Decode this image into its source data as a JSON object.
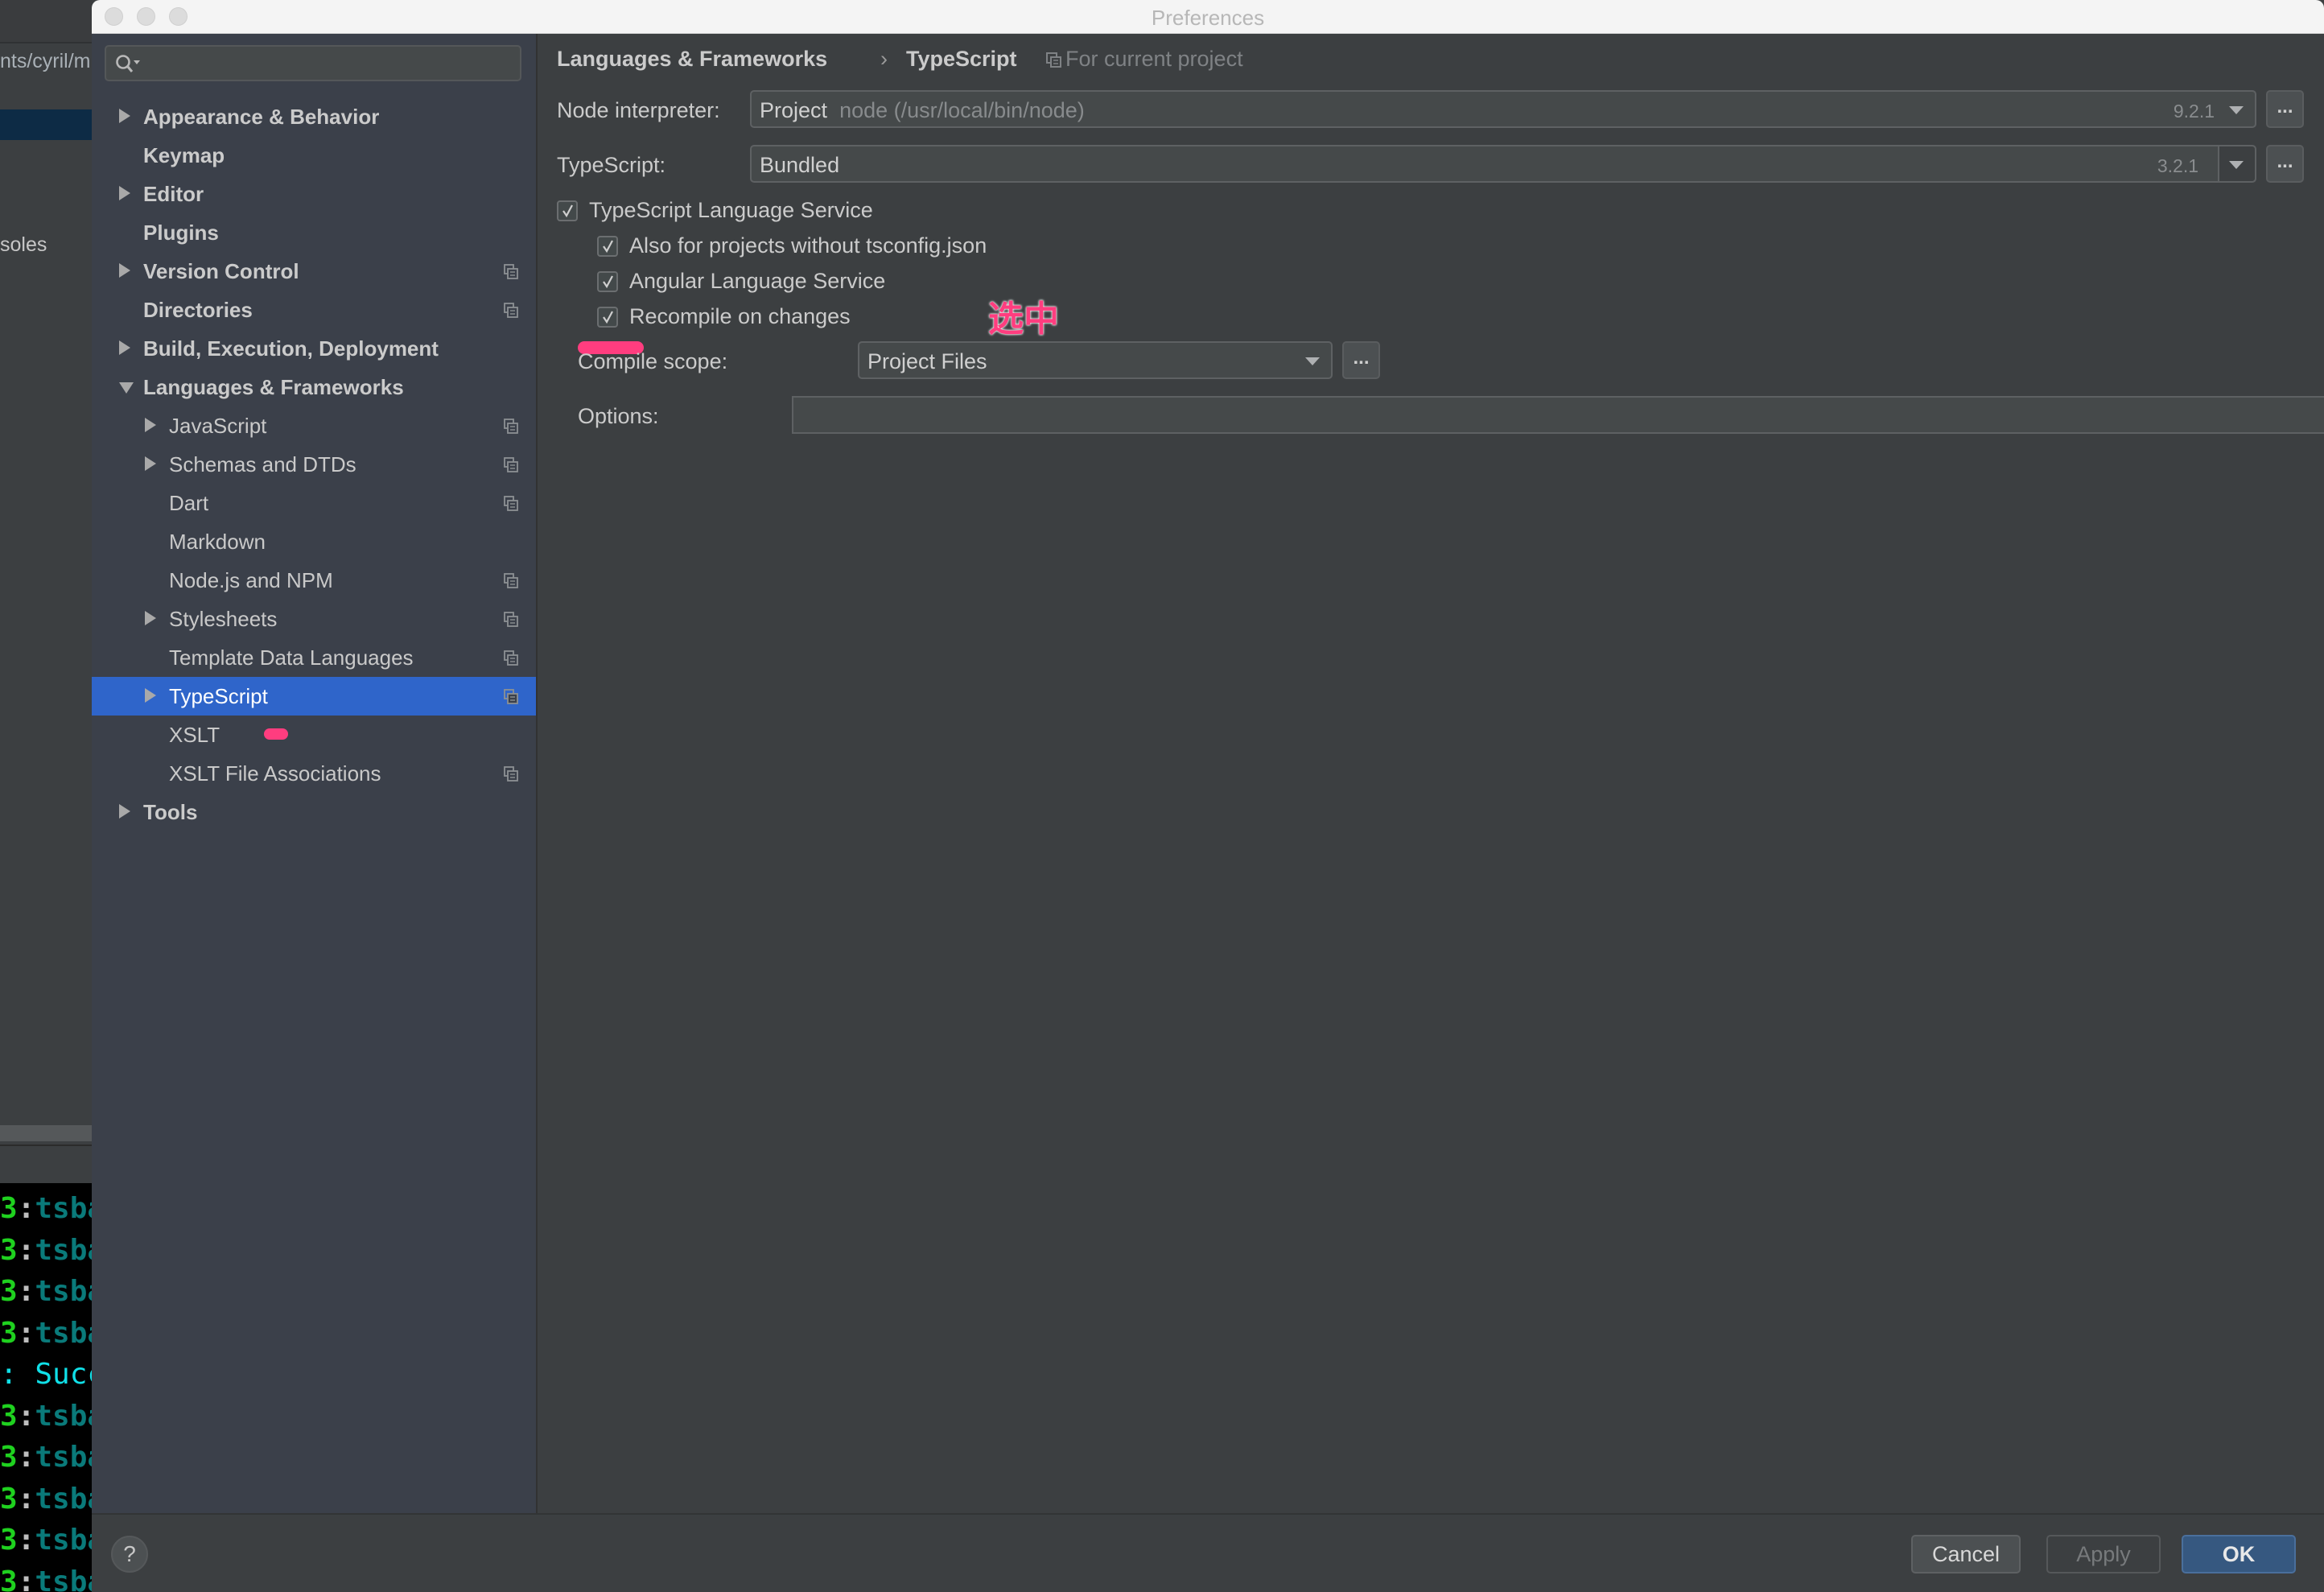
{
  "window": {
    "title": "Preferences"
  },
  "background_ide": {
    "path_fragment": "nts/cyril/m",
    "consoles_fragment": "soles",
    "terminal_lines": [
      {
        "num": "3",
        "colon": ":",
        "host": "tsba"
      },
      {
        "num": "3",
        "colon": ":",
        "host": "tsba"
      },
      {
        "num": "3",
        "colon": ":",
        "host": "tsba"
      },
      {
        "num": "3",
        "colon": ":",
        "host": "tsba"
      },
      {
        "num": "",
        "colon": ":",
        "host": "Succ",
        "type": "success"
      },
      {
        "num": "3",
        "colon": ":",
        "host": "tsba"
      },
      {
        "num": "3",
        "colon": ":",
        "host": "tsba"
      },
      {
        "num": "3",
        "colon": ":",
        "host": "tsba"
      },
      {
        "num": "3",
        "colon": ":",
        "host": "tsba"
      },
      {
        "num": "3",
        "colon": ":",
        "host": "tsba"
      }
    ]
  },
  "sidebar": {
    "search": {
      "placeholder": "",
      "value": "",
      "icon": "search-icon"
    },
    "items": [
      {
        "label": "Appearance & Behavior",
        "level": 0,
        "expandable": true,
        "expanded": false,
        "project_icon": false
      },
      {
        "label": "Keymap",
        "level": 0,
        "expandable": false,
        "project_icon": false
      },
      {
        "label": "Editor",
        "level": 0,
        "expandable": true,
        "expanded": false,
        "project_icon": false
      },
      {
        "label": "Plugins",
        "level": 0,
        "expandable": false,
        "project_icon": false
      },
      {
        "label": "Version Control",
        "level": 0,
        "expandable": true,
        "expanded": false,
        "project_icon": true
      },
      {
        "label": "Directories",
        "level": 0,
        "expandable": false,
        "project_icon": true
      },
      {
        "label": "Build, Execution, Deployment",
        "level": 0,
        "expandable": true,
        "expanded": false,
        "project_icon": false
      },
      {
        "label": "Languages & Frameworks",
        "level": 0,
        "expandable": true,
        "expanded": true,
        "project_icon": false
      },
      {
        "label": "JavaScript",
        "level": 1,
        "expandable": true,
        "expanded": false,
        "project_icon": true
      },
      {
        "label": "Schemas and DTDs",
        "level": 1,
        "expandable": true,
        "expanded": false,
        "project_icon": true
      },
      {
        "label": "Dart",
        "level": 1,
        "expandable": false,
        "project_icon": true
      },
      {
        "label": "Markdown",
        "level": 1,
        "expandable": false,
        "project_icon": false
      },
      {
        "label": "Node.js and NPM",
        "level": 1,
        "expandable": false,
        "project_icon": true
      },
      {
        "label": "Stylesheets",
        "level": 1,
        "expandable": true,
        "expanded": false,
        "project_icon": true
      },
      {
        "label": "Template Data Languages",
        "level": 1,
        "expandable": false,
        "project_icon": true
      },
      {
        "label": "TypeScript",
        "level": 1,
        "expandable": true,
        "expanded": false,
        "project_icon": true,
        "selected": true
      },
      {
        "label": "XSLT",
        "level": 1,
        "expandable": false,
        "project_icon": false
      },
      {
        "label": "XSLT File Associations",
        "level": 1,
        "expandable": false,
        "project_icon": true
      },
      {
        "label": "Tools",
        "level": 0,
        "expandable": true,
        "expanded": false,
        "project_icon": false
      }
    ]
  },
  "main": {
    "breadcrumb": {
      "parent": "Languages & Frameworks",
      "separator": "›",
      "current": "TypeScript",
      "scope_note": "For current project"
    },
    "node_interpreter": {
      "label": "Node interpreter:",
      "value_main": "Project",
      "value_sub": "node (/usr/local/bin/node)",
      "version": "9.2.1",
      "more_label": "..."
    },
    "typescript": {
      "label": "TypeScript:",
      "value": "Bundled",
      "version": "3.2.1",
      "more_label": "..."
    },
    "checkboxes": [
      {
        "label": "TypeScript Language Service",
        "checked": true
      },
      {
        "label": "Also for projects without tsconfig.json",
        "checked": true
      },
      {
        "label": "Angular Language Service",
        "checked": true
      },
      {
        "label": "Recompile on changes",
        "checked": true
      }
    ],
    "compile_scope": {
      "label": "Compile scope:",
      "value": "Project Files",
      "more_label": "..."
    },
    "options": {
      "label": "Options:",
      "value": ""
    },
    "annotation": {
      "text": "选中",
      "color": "#ff3d7f"
    }
  },
  "footer": {
    "help_label": "?",
    "cancel_label": "Cancel",
    "apply_label": "Apply",
    "ok_label": "OK"
  },
  "colors": {
    "selection": "#2f65ca",
    "ok_button": "#365880",
    "sidebar_bg": "#3b404a",
    "panel_bg": "#3c3f41",
    "annotation": "#ff3d7f"
  }
}
